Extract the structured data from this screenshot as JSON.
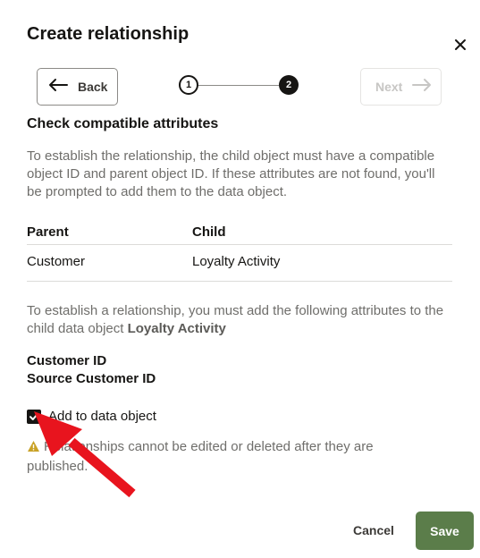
{
  "dialog": {
    "title": "Create relationship",
    "close_icon": "close-icon"
  },
  "nav": {
    "back_label": "Back",
    "next_label": "Next",
    "steps": [
      "1",
      "2"
    ],
    "current_step": 2
  },
  "section": {
    "title": "Check compatible attributes",
    "help": "To establish the relationship, the child object must have a compatible object ID and parent object ID. If these attributes are not found, you'll be prompted to add them to the data object."
  },
  "table": {
    "headers": [
      "Parent",
      "Child"
    ],
    "rows": [
      [
        "Customer",
        "Loyalty Activity"
      ]
    ]
  },
  "attributes": {
    "help_prefix": "To establish a relationship, you must add the following attributes to the child data object ",
    "object_name": "Loyalty Activity",
    "items": [
      "Customer ID",
      "Source Customer ID"
    ]
  },
  "checkbox": {
    "label": "Add to data object",
    "checked": true
  },
  "warning": {
    "text": "Relationships cannot be edited or deleted after they are published."
  },
  "footer": {
    "cancel_label": "Cancel",
    "save_label": "Save"
  },
  "colors": {
    "save_bg": "#5b7d4a",
    "annotation_arrow": "#e8141e",
    "warning_icon": "#c9a227"
  }
}
